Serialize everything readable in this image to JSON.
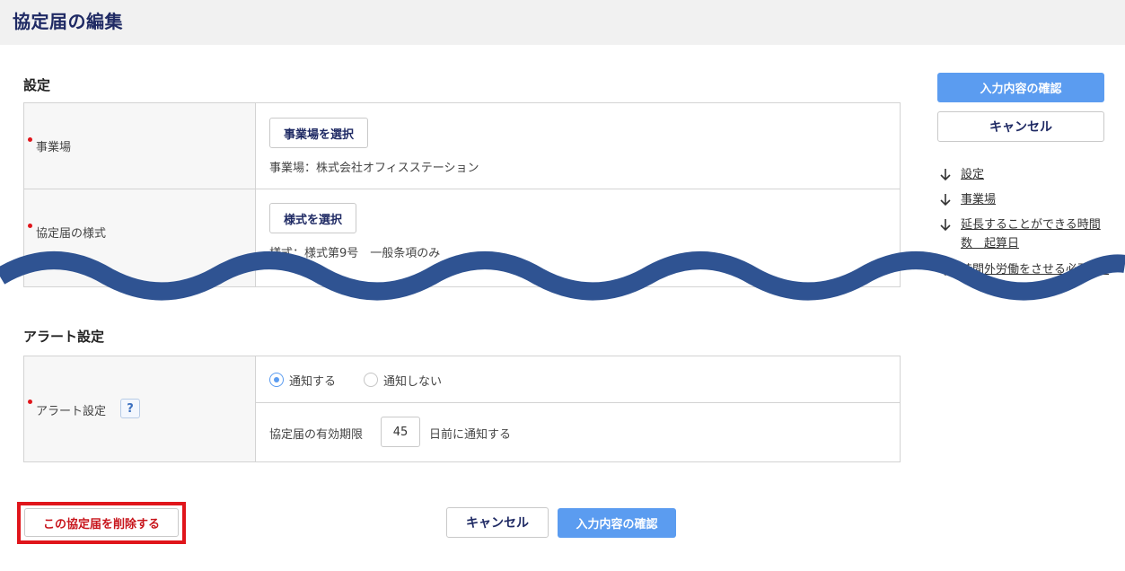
{
  "header": {
    "title": "協定届の編集"
  },
  "settings": {
    "section_title": "設定",
    "office": {
      "label": "事業場",
      "button": "事業場を選択",
      "value": "事業場：株式会社オフィスステーション"
    },
    "form_style": {
      "label": "協定届の様式",
      "button": "様式を選択",
      "value": "様式：様式第9号　一般条項のみ"
    }
  },
  "alert": {
    "section_title": "アラート設定",
    "label": "アラート設定",
    "help_glyph": "?",
    "options": [
      "通知する",
      "通知しない"
    ],
    "selected": "通知する",
    "expiry_label": "協定届の有効期限",
    "days": "45",
    "days_suffix": "日前に通知する"
  },
  "side": {
    "confirm_button": "入力内容の確認",
    "cancel_button": "キャンセル",
    "anchors": [
      "設定",
      "事業場",
      "延長することができる時間数　起算日",
      "時間外労働をさせる必要のある具体的事由 ②"
    ]
  },
  "footer": {
    "delete_button": "この協定届を削除する",
    "cancel_button": "キャンセル",
    "confirm_button": "入力内容の確認"
  },
  "colors": {
    "accent": "#5b9cf0",
    "title": "#1f2a64",
    "required": "#e0151b",
    "wave": "#2f5392",
    "highlight": "#e0151b"
  }
}
